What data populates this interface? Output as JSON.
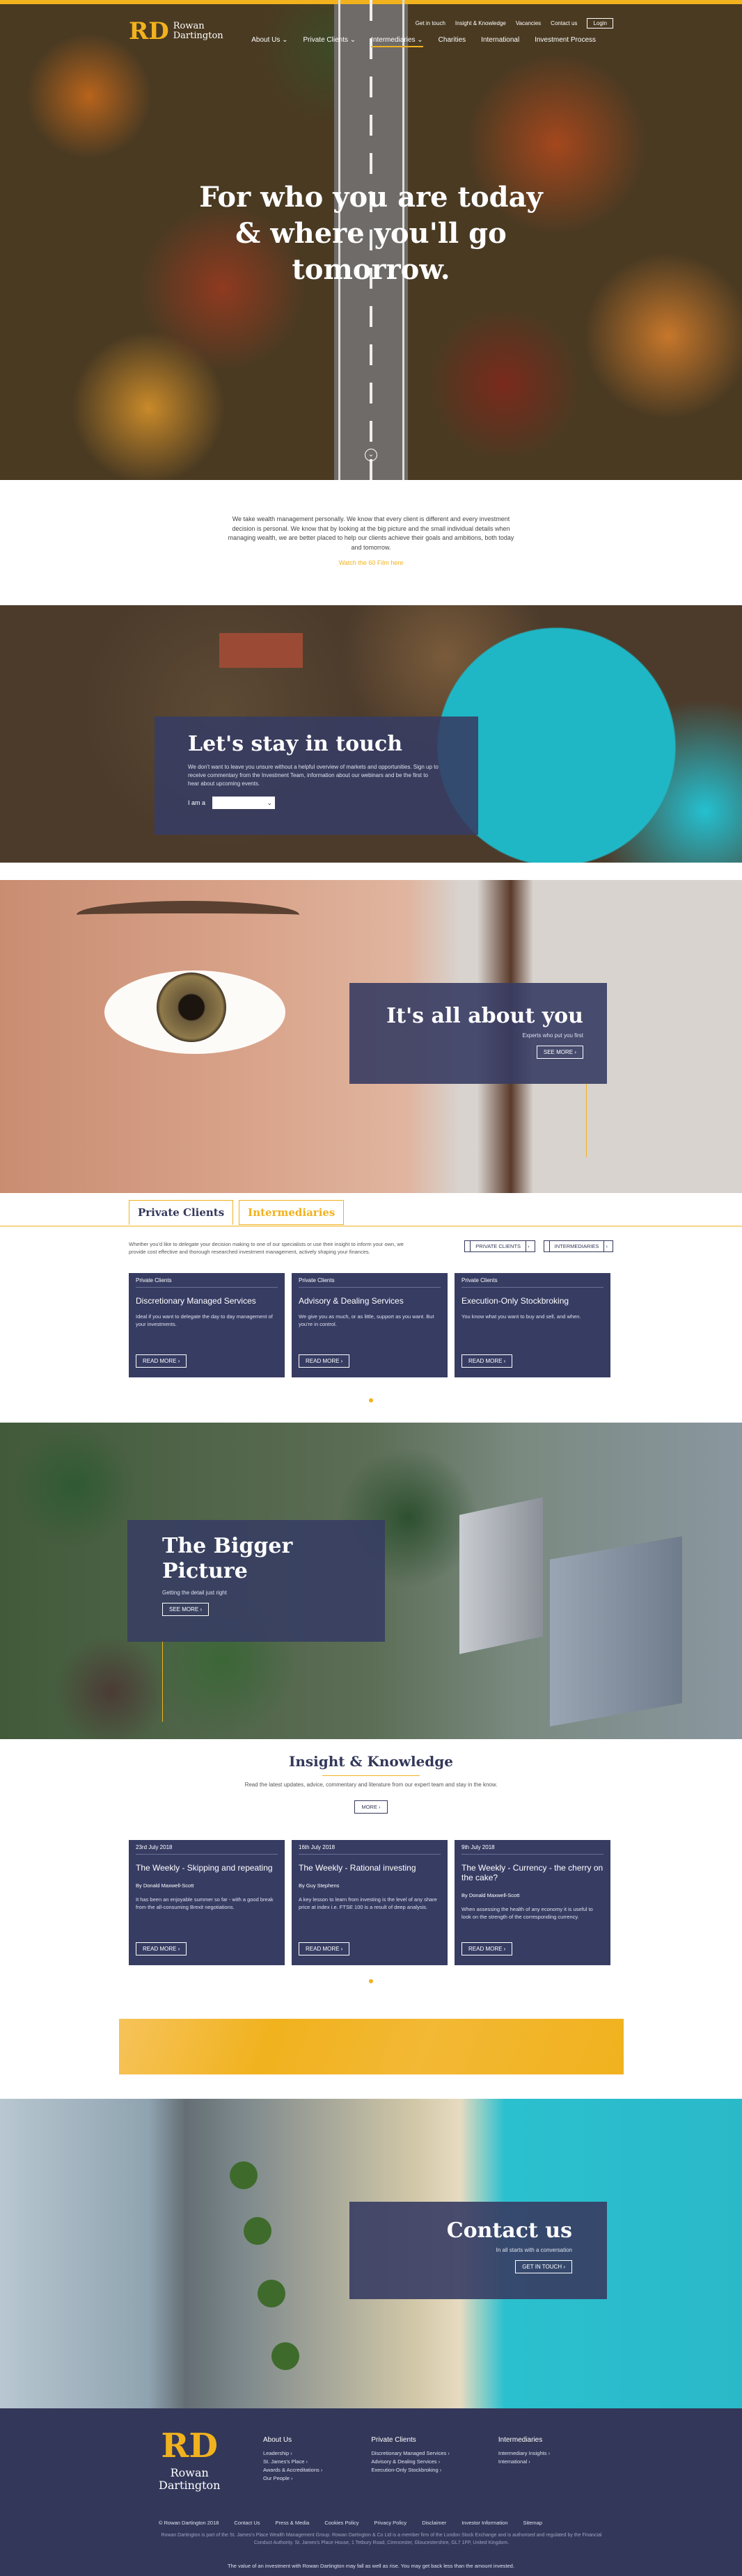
{
  "brand": {
    "mark": "RD",
    "name_line1": "Rowan",
    "name_line2": "Dartington"
  },
  "utility_nav": {
    "get_in_touch": "Get in touch",
    "insight": "Insight & Knowledge",
    "vacancies": "Vacancies",
    "contact": "Contact us",
    "login": "Login"
  },
  "main_nav": [
    "About Us ⌄",
    "Private Clients ⌄",
    "Intermediaries ⌄",
    "Charities",
    "International",
    "Investment Process"
  ],
  "hero": {
    "headline": "For who you are today & where you'll go tomorrow."
  },
  "intro": {
    "text": "We take wealth management personally. We know that every client is different and every investment decision is personal. We know that by looking at the big picture and the small individual details when managing wealth, we are better placed to help our clients achieve their goals and ambitions, both today and tomorrow.",
    "video_link": "Watch the 60 Film here"
  },
  "stay": {
    "title": "Let's stay in touch",
    "text": "We don't want to leave you unsure without a helpful overview of markets and opportunities. Sign up to receive commentary from the Investment Team, information about our webinars and be the first to hear about upcoming events.",
    "i_am_label": "I am a",
    "select_value": ""
  },
  "about": {
    "title": "It's all about you",
    "text": "Experts who put you first",
    "button": "SEE MORE"
  },
  "tabs": {
    "tab1": "Private Clients",
    "tab2": "Intermediaries",
    "description": "Whether you'd like to delegate your decision making to one of our specialists or use their insight to inform your own, we provide cost effective and thorough researched investment management, actively shaping your finances.",
    "btn1": "PRIVATE CLIENTS",
    "btn2": "INTERMEDIARIES",
    "cards": [
      {
        "label": "Private Clients",
        "title": "Discretionary Managed Services",
        "text": "Ideal if you want to delegate the day to day management of your investments.",
        "button": "READ MORE"
      },
      {
        "label": "Private Clients",
        "title": "Advisory & Dealing Services",
        "text": "We give you as much, or as little, support as you want. But you're in control.",
        "button": "READ MORE"
      },
      {
        "label": "Private Clients",
        "title": "Execution-Only Stockbroking",
        "text": "You know what you want to buy and sell, and when.",
        "button": "READ MORE"
      }
    ]
  },
  "bigger": {
    "title_line1": "The Bigger",
    "title_line2": "Picture",
    "text": "Getting the detail just right",
    "button": "SEE MORE"
  },
  "insight": {
    "title": "Insight & Knowledge",
    "lead": "Read the latest updates, advice, commentary and literature from our expert team and stay in the know.",
    "more": "MORE",
    "cards": [
      {
        "date": "23rd July 2018",
        "title": "The Weekly - Skipping and repeating",
        "by": "By Donald Maxwell-Scott",
        "text": "It has been an enjoyable summer so far - with a good break from the all-consuming Brexit negotiations.",
        "button": "READ MORE"
      },
      {
        "date": "16th July 2018",
        "title": "The Weekly - Rational investing",
        "by": "By Guy Stephens",
        "text": "A key lesson to learn from investing is the level of any share price at index i.e. FTSE 100 is a result of deep analysis.",
        "button": "READ MORE"
      },
      {
        "date": "9th July 2018",
        "title": "The Weekly - Currency - the cherry on the cake?",
        "by": "By Donald Maxwell-Scott",
        "text": "When assessing the health of any economy it is useful to look on the strength of the corresponding currency.",
        "button": "READ MORE"
      }
    ]
  },
  "contact": {
    "title": "Contact us",
    "text": "In all starts with a conversation",
    "button": "GET IN TOUCH"
  },
  "footer": {
    "col1": {
      "heading": "About Us",
      "items": [
        "Leadership ›",
        "St. James's Place ›",
        "Awards & Accreditations ›",
        "Our People ›"
      ]
    },
    "col2": {
      "heading": "Private Clients",
      "items": [
        "Discretionary Managed Services ›",
        "Advisory & Dealing Services ›",
        "Execution-Only Stockbroking ›"
      ]
    },
    "col3": {
      "heading": "Intermediaries",
      "items": [
        "Intermediary Insights ›",
        "International ›"
      ]
    },
    "links": [
      "© Rowan Dartington 2018",
      "Contact Us",
      "Press & Media",
      "Cookies Policy",
      "Privacy Policy",
      "Disclaimer",
      "Investor Information",
      "Sitemap"
    ],
    "legal": "Rowan Dartington is part of the St. James's Place Wealth Management Group. Rowan Dartington & Co Ltd is a member firm of the London Stock Exchange and is authorised and regulated by the Financial Conduct Authority. St. James's Place House, 1 Tetbury Road, Cirencester, Gloucestershire, GL7 1FP, United Kingdom.",
    "risk": "The value of an investment with Rowan Dartington may fall as well as rise. You may get back less than the amount invested."
  }
}
